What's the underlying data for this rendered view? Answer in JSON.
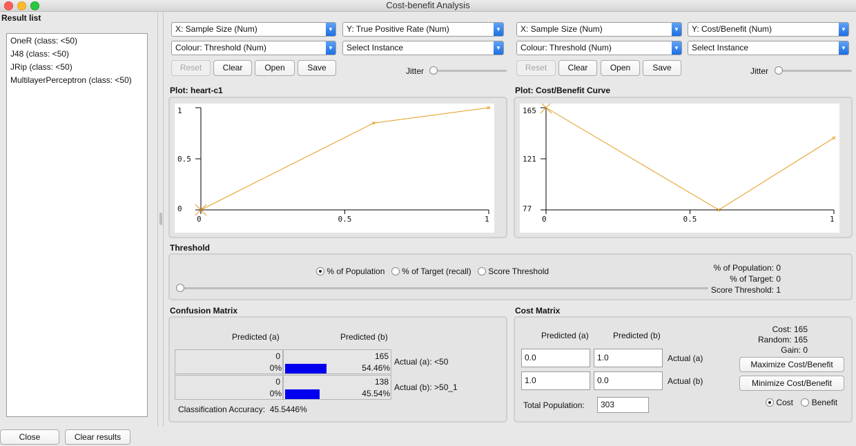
{
  "window": {
    "title": "Cost-benefit Analysis"
  },
  "result_list": {
    "title": "Result list",
    "items": [
      "OneR (class: <50)",
      "J48 (class: <50)",
      "JRip (class: <50)",
      "MultilayerPerceptron (class: <50)"
    ],
    "close_label": "Close",
    "clear_results_label": "Clear results"
  },
  "left_controls": {
    "x_axis": "X: Sample Size (Num)",
    "y_axis": "Y: True Positive Rate (Num)",
    "colour": "Colour: Threshold (Num)",
    "instance": "Select Instance",
    "reset": "Reset",
    "clear": "Clear",
    "open": "Open",
    "save": "Save",
    "jitter": "Jitter"
  },
  "right_controls": {
    "x_axis": "X: Sample Size (Num)",
    "y_axis": "Y: Cost/Benefit (Num)",
    "colour": "Colour: Threshold (Num)",
    "instance": "Select Instance",
    "reset": "Reset",
    "clear": "Clear",
    "open": "Open",
    "save": "Save",
    "jitter": "Jitter"
  },
  "plot_left": {
    "title": "Plot: heart-c1"
  },
  "plot_right": {
    "title": "Plot: Cost/Benefit Curve"
  },
  "chart_data": [
    {
      "type": "line",
      "title": "Plot: heart-c1",
      "x": [
        0,
        0.6,
        1
      ],
      "y": [
        0,
        0.85,
        1
      ],
      "xlim": [
        0,
        1
      ],
      "ylim": [
        0,
        1
      ],
      "x_ticks": [
        "0",
        "0.5",
        "1"
      ],
      "y_ticks": [
        "1",
        "0.5",
        "0"
      ],
      "line_color": "#e39a1c"
    },
    {
      "type": "line",
      "title": "Plot: Cost/Benefit Curve",
      "x": [
        0,
        0.6,
        1
      ],
      "y": [
        165,
        77,
        139
      ],
      "xlim": [
        0,
        1
      ],
      "ylim": [
        77,
        165
      ],
      "x_ticks": [
        "0",
        "0.5",
        "1"
      ],
      "y_ticks": [
        "165",
        "121",
        "77"
      ],
      "line_color": "#e39a1c"
    }
  ],
  "threshold": {
    "title": "Threshold",
    "options": [
      "% of Population",
      "% of Target (recall)",
      "Score Threshold"
    ],
    "selected": "% of Population",
    "slider_value": 0,
    "stats": [
      "% of Population: 0",
      "% of Target: 0",
      "Score Threshold: 1"
    ]
  },
  "confusion": {
    "title": "Confusion Matrix",
    "pred_a": "Predicted (a)",
    "pred_b": "Predicted (b)",
    "rows": [
      {
        "a_count": "0",
        "a_pct": "0%",
        "b_count": "165",
        "b_pct": "54.46%",
        "b_fraction": 0.5446,
        "label": "Actual (a): <50"
      },
      {
        "a_count": "0",
        "a_pct": "0%",
        "b_count": "138",
        "b_pct": "45.54%",
        "b_fraction": 0.4554,
        "label": "Actual (b): >50_1"
      }
    ],
    "accuracy": "Classification Accuracy:  45.5446%"
  },
  "cost": {
    "title": "Cost Matrix",
    "pred_a": "Predicted (a)",
    "pred_b": "Predicted (b)",
    "row1": [
      "0.0",
      "1.0"
    ],
    "row1_label": "Actual (a)",
    "row2": [
      "1.0",
      "0.0"
    ],
    "row2_label": "Actual (b)",
    "total_label": "Total Population:",
    "total_value": "303",
    "summary": [
      "Cost: 165",
      "Random: 165",
      "Gain: 0"
    ],
    "maximize": "Maximize Cost/Benefit",
    "minimize": "Minimize Cost/Benefit",
    "mode_cost": "Cost",
    "mode_benefit": "Benefit",
    "mode_selected": "Cost"
  }
}
